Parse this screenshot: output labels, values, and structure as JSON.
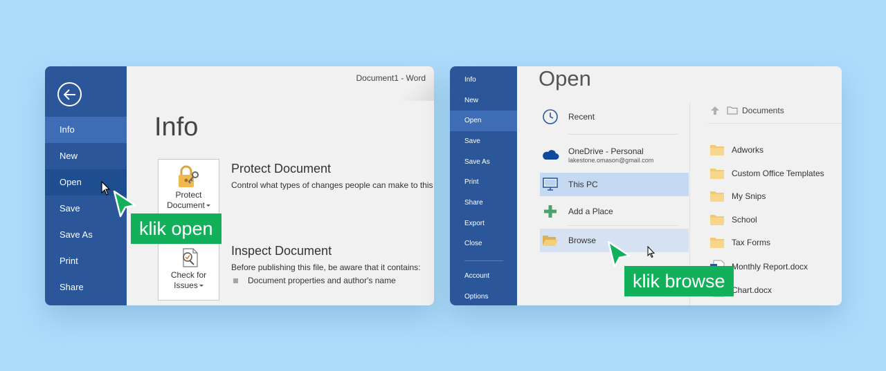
{
  "panel_info": {
    "window_title": "Document1 - Word",
    "heading": "Info",
    "sidebar": [
      "Info",
      "New",
      "Open",
      "Save",
      "Save As",
      "Print",
      "Share"
    ],
    "protect": {
      "tile_line1": "Protect",
      "tile_line2": "Document",
      "title": "Protect Document",
      "desc": "Control what types of changes people can make to this"
    },
    "inspect": {
      "tile_line1": "Check for",
      "tile_line2": "Issues",
      "title": "Inspect Document",
      "desc": "Before publishing this file, be aware that it contains:",
      "bullet": "Document properties and author's name"
    },
    "callout": "klik open"
  },
  "panel_open": {
    "heading": "Open",
    "sidebar": [
      "Info",
      "New",
      "Open",
      "Save",
      "Save As",
      "Print",
      "Share",
      "Export",
      "Close",
      "Account",
      "Options"
    ],
    "locations": {
      "recent": "Recent",
      "onedrive": "OneDrive - Personal",
      "onedrive_email": "lakestone.omason@gmail.com",
      "this_pc": "This PC",
      "add_place": "Add a Place",
      "browse": "Browse"
    },
    "breadcrumb": "Documents",
    "folders": [
      "Adworks",
      "Custom Office Templates",
      "My Snips",
      "School",
      "Tax Forms"
    ],
    "files": [
      "Monthly Report.docx",
      "Chart.docx"
    ],
    "callout": "klik browse"
  },
  "colors": {
    "background": "#addcfb",
    "word_blue": "#2b579a",
    "callout_green": "#13b05c"
  }
}
